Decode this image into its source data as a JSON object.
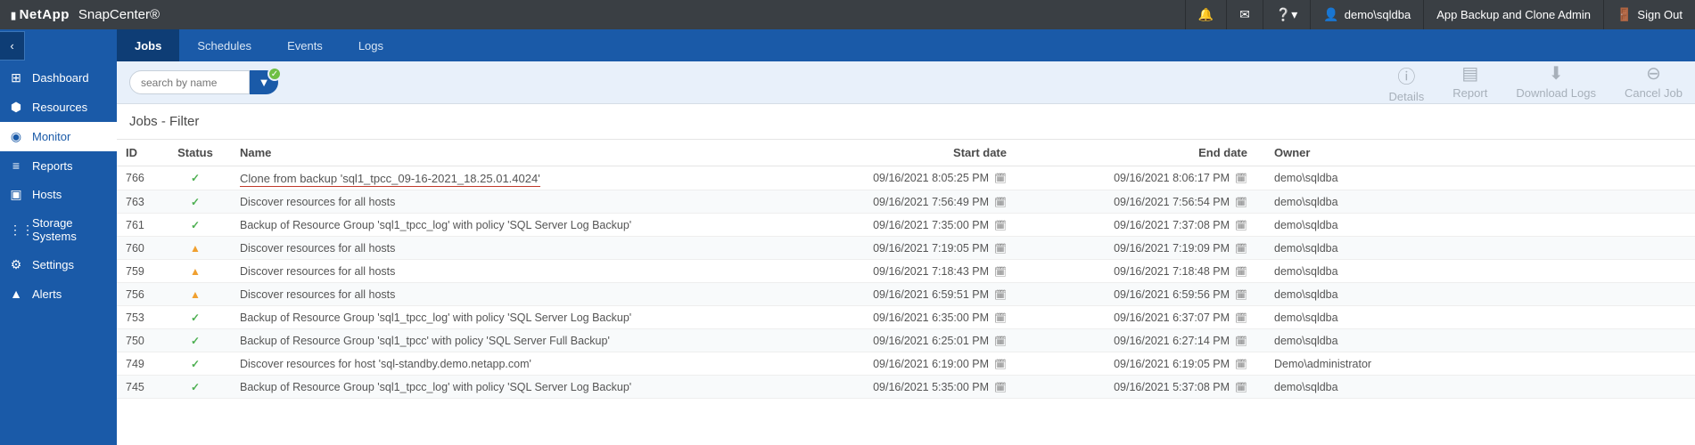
{
  "header": {
    "brand": "NetApp",
    "product": "SnapCenter®",
    "user": "demo\\sqldba",
    "role": "App Backup and Clone Admin",
    "signout": "Sign Out"
  },
  "tabs": [
    {
      "label": "Jobs",
      "active": true
    },
    {
      "label": "Schedules"
    },
    {
      "label": "Events"
    },
    {
      "label": "Logs"
    }
  ],
  "sidebar": [
    {
      "icon": "⊞",
      "label": "Dashboard"
    },
    {
      "icon": "⬢",
      "label": "Resources"
    },
    {
      "icon": "◉",
      "label": "Monitor",
      "active": true
    },
    {
      "icon": "≡",
      "label": "Reports"
    },
    {
      "icon": "▣",
      "label": "Hosts"
    },
    {
      "icon": "⋮⋮",
      "label": "Storage Systems"
    },
    {
      "icon": "⚙",
      "label": "Settings"
    },
    {
      "icon": "▲",
      "label": "Alerts"
    }
  ],
  "search": {
    "placeholder": "search by name"
  },
  "actions": [
    {
      "icon": "ⓘ",
      "label": "Details"
    },
    {
      "icon": "▤",
      "label": "Report"
    },
    {
      "icon": "⬇",
      "label": "Download Logs"
    },
    {
      "icon": "⊖",
      "label": "Cancel Job"
    }
  ],
  "page": {
    "title": "Jobs - Filter"
  },
  "columns": {
    "id": "ID",
    "status": "Status",
    "name": "Name",
    "start": "Start date",
    "end": "End date",
    "owner": "Owner"
  },
  "rows": [
    {
      "id": "766",
      "st": "ok",
      "name": "Clone from backup 'sql1_tpcc_09-16-2021_18.25.01.4024'",
      "underline": true,
      "start": "09/16/2021 8:05:25 PM",
      "end": "09/16/2021 8:06:17 PM",
      "owner": "demo\\sqldba"
    },
    {
      "id": "763",
      "st": "ok",
      "name": "Discover resources for all hosts",
      "start": "09/16/2021 7:56:49 PM",
      "end": "09/16/2021 7:56:54 PM",
      "owner": "demo\\sqldba"
    },
    {
      "id": "761",
      "st": "ok",
      "name": "Backup of Resource Group 'sql1_tpcc_log' with policy 'SQL Server Log Backup'",
      "start": "09/16/2021 7:35:00 PM",
      "end": "09/16/2021 7:37:08 PM",
      "owner": "demo\\sqldba"
    },
    {
      "id": "760",
      "st": "wn",
      "name": "Discover resources for all hosts",
      "start": "09/16/2021 7:19:05 PM",
      "end": "09/16/2021 7:19:09 PM",
      "owner": "demo\\sqldba"
    },
    {
      "id": "759",
      "st": "wn",
      "name": "Discover resources for all hosts",
      "start": "09/16/2021 7:18:43 PM",
      "end": "09/16/2021 7:18:48 PM",
      "owner": "demo\\sqldba"
    },
    {
      "id": "756",
      "st": "wn",
      "name": "Discover resources for all hosts",
      "start": "09/16/2021 6:59:51 PM",
      "end": "09/16/2021 6:59:56 PM",
      "owner": "demo\\sqldba"
    },
    {
      "id": "753",
      "st": "ok",
      "name": "Backup of Resource Group 'sql1_tpcc_log' with policy 'SQL Server Log Backup'",
      "start": "09/16/2021 6:35:00 PM",
      "end": "09/16/2021 6:37:07 PM",
      "owner": "demo\\sqldba"
    },
    {
      "id": "750",
      "st": "ok",
      "name": "Backup of Resource Group 'sql1_tpcc' with policy 'SQL Server Full Backup'",
      "start": "09/16/2021 6:25:01 PM",
      "end": "09/16/2021 6:27:14 PM",
      "owner": "demo\\sqldba"
    },
    {
      "id": "749",
      "st": "ok",
      "name": "Discover resources for host 'sql-standby.demo.netapp.com'",
      "start": "09/16/2021 6:19:00 PM",
      "end": "09/16/2021 6:19:05 PM",
      "owner": "Demo\\administrator"
    },
    {
      "id": "745",
      "st": "ok",
      "name": "Backup of Resource Group 'sql1_tpcc_log' with policy 'SQL Server Log Backup'",
      "start": "09/16/2021 5:35:00 PM",
      "end": "09/16/2021 5:37:08 PM",
      "owner": "demo\\sqldba"
    }
  ]
}
